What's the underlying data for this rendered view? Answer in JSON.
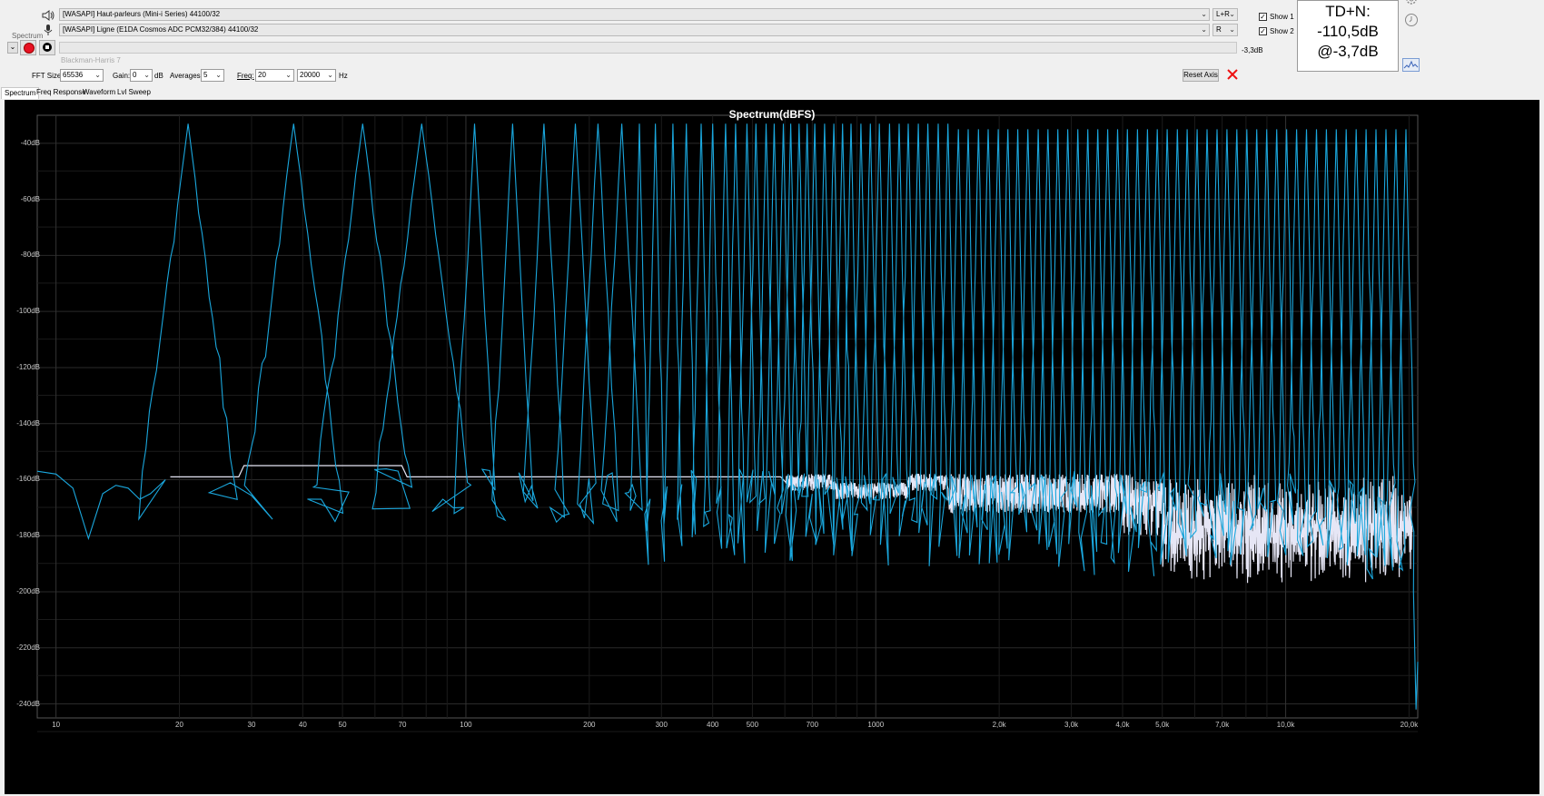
{
  "devices": {
    "output": "[WASAPI] Haut-parleurs (Mini-i Series) 44100/32",
    "output_channel": "L+R",
    "input": "[WASAPI] Ligne (E1DA Cosmos ADC PCM32/384) 44100/32",
    "input_channel": "R"
  },
  "level_readout": "-3,3dB",
  "spectrum_label": "Spectrum",
  "window_label": "Blackman-Harris 7",
  "controls": {
    "fft_label": "FFT Size:",
    "fft_value": "65536",
    "gain_label": "Gain:",
    "gain_value": "0",
    "gain_unit": "dB",
    "avg_label": "Averages:",
    "avg_value": "5",
    "freq_label": "Freq:",
    "freq_from": "20",
    "freq_to": "20000",
    "freq_unit": "Hz",
    "reset_axis": "Reset Axis"
  },
  "show": {
    "show1": "Show 1",
    "show2": "Show 2",
    "checked": [
      true,
      true
    ]
  },
  "tdn": {
    "line1": "TD+N:",
    "line2": "-110,5dB",
    "line3": "@-3,7dB"
  },
  "tabs": [
    "Spectrum",
    "Freq Response",
    "Waveform",
    "Lvl Sweep"
  ],
  "colors": {
    "trace1": "#1aa7dd",
    "trace2": "#e6e6f5",
    "background": "#000000",
    "grid": "#2a2a2a"
  },
  "chart_data": {
    "type": "line",
    "title": "Spectrum(dBFS)",
    "x_scale": "log",
    "xlim": [
      9,
      21000
    ],
    "ylim": [
      -245,
      -30
    ],
    "grid": true,
    "y_ticks": [
      "-40dB",
      "-60dB",
      "-80dB",
      "-100dB",
      "-120dB",
      "-140dB",
      "-160dB",
      "-180dB",
      "-200dB",
      "-220dB",
      "-240dB"
    ],
    "y_tick_values": [
      -40,
      -60,
      -80,
      -100,
      -120,
      -140,
      -160,
      -180,
      -200,
      -220,
      -240
    ],
    "x_ticks": [
      "10",
      "20",
      "30",
      "40",
      "50",
      "70",
      "100",
      "200",
      "300",
      "400",
      "500",
      "700",
      "1000",
      "2,0k",
      "3,0k",
      "4,0k",
      "5,0k",
      "7,0k",
      "10,0k",
      "20,0k"
    ],
    "x_tick_values": [
      10,
      20,
      30,
      40,
      50,
      70,
      100,
      200,
      300,
      400,
      500,
      700,
      1000,
      2000,
      3000,
      4000,
      5000,
      7000,
      10000,
      20000
    ],
    "series": [
      {
        "peak_frequencies_hz": [
          21,
          38,
          56,
          78,
          105,
          130,
          155,
          185,
          210,
          240,
          265,
          290,
          320,
          345,
          375,
          400,
          430,
          455,
          485,
          510,
          540,
          565,
          595,
          620,
          650,
          680,
          710,
          750,
          790,
          830,
          870,
          920,
          970,
          1020,
          1080,
          1140,
          1200,
          1270,
          1340,
          1420,
          1500,
          1590,
          1680,
          1780,
          1880,
          1990,
          2100,
          2220,
          2350,
          2490,
          2630,
          2780,
          2940,
          3110,
          3290,
          3480,
          3680,
          3890,
          4110,
          4350,
          4600,
          4860,
          5140,
          5440,
          5750,
          6080,
          6430,
          6800,
          7190,
          7600,
          8040,
          8500,
          8990,
          9510,
          10050,
          10630,
          11240,
          11890,
          12570,
          13290,
          14050,
          14860,
          15710,
          16610,
          17570,
          18580,
          19650
        ],
        "peak_level_db": -33,
        "noise_floor_db": -160
      },
      {
        "step_floor_db": -159,
        "x_start_hz": 19
      }
    ]
  }
}
